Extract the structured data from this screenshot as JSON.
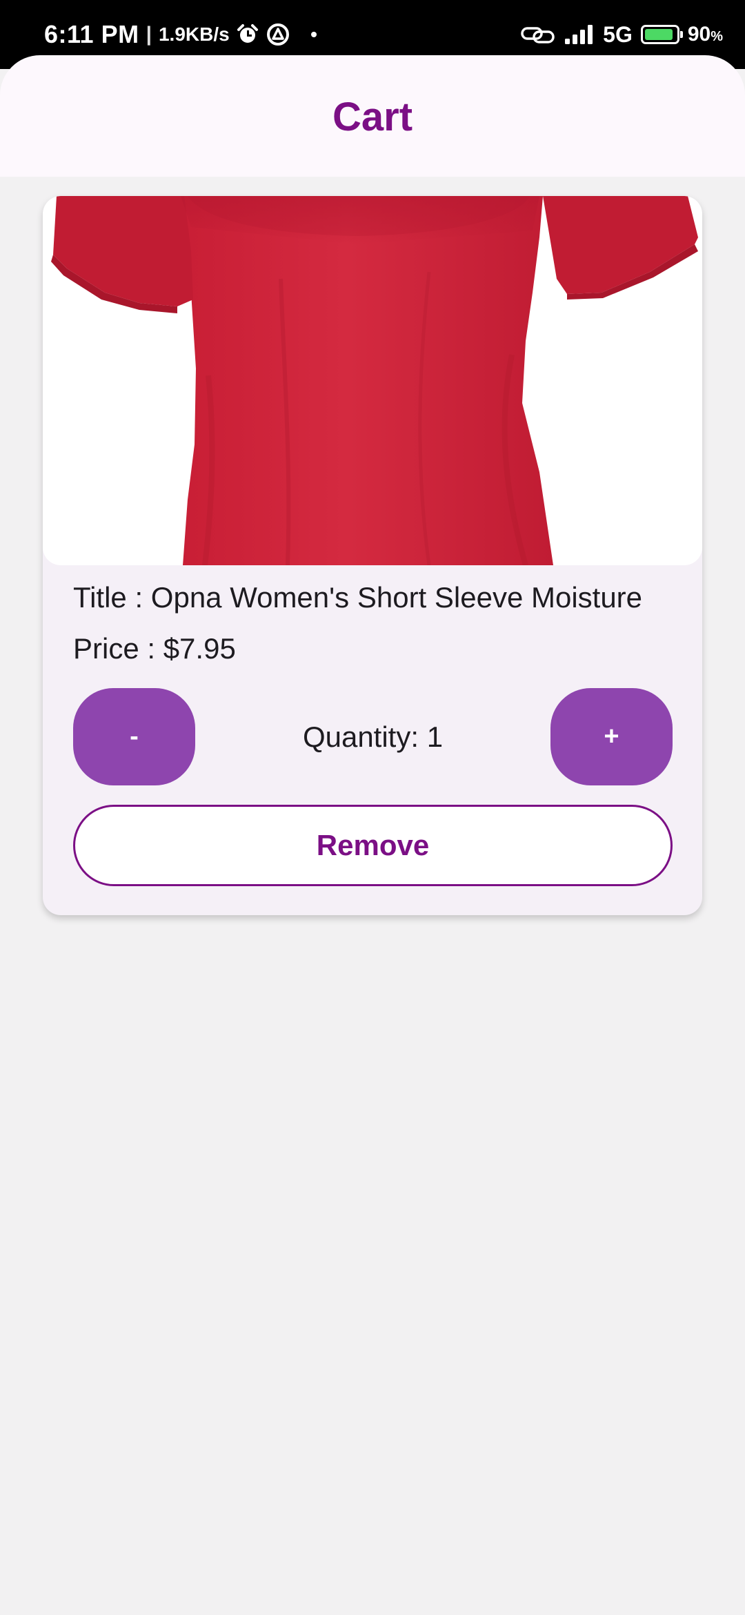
{
  "status_bar": {
    "time": "6:11 PM",
    "separator": "|",
    "net_speed": "1.9KB/s",
    "network_type": "5G",
    "battery_percent": "90",
    "battery_unit": "%",
    "battery_level": 0.9,
    "battery_color": "#4cd964",
    "icons": [
      "alarm-icon",
      "sync-icon",
      "dot-icon",
      "link-icon",
      "signal-icon",
      "battery-icon"
    ]
  },
  "header": {
    "title": "Cart",
    "title_color": "#7b0f85"
  },
  "cart": {
    "items": [
      {
        "image": "red-short-sleeve-shirt",
        "title": "Title : Opna Women's Short Sleeve Moisture",
        "price": "Price : $7.95",
        "decrement_label": "-",
        "increment_label": "+",
        "quantity": "Quantity: 1",
        "remove_label": "Remove"
      }
    ]
  },
  "colors": {
    "accent": "#8e45ae",
    "brand": "#7b0f85",
    "card_bg": "#f5f0f7",
    "page_bg": "#f2f1f2"
  }
}
